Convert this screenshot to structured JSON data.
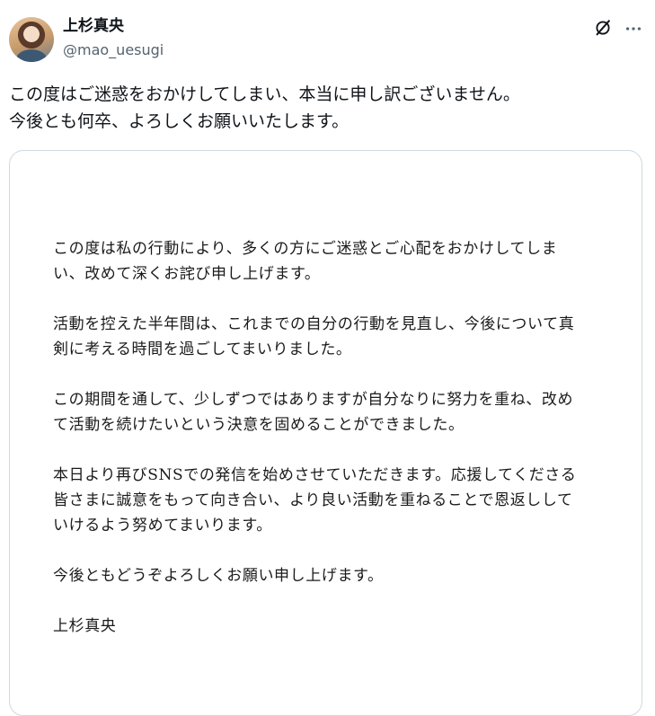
{
  "post": {
    "author": {
      "display_name": "上杉真央",
      "handle": "@mao_uesugi"
    },
    "text_lines": [
      "この度はご迷惑をおかけしてしまい、本当に申し訳ございません。",
      "今後とも何卒、よろしくお願いいたします。"
    ],
    "image": {
      "paragraphs": [
        "この度は私の行動により、多くの方にご迷惑とご心配をおかけしてしま\nい、改めて深くお詫び申し上げます。",
        "活動を控えた半年間は、これまでの自分の行動を見直し、今後について真\n剣に考える時間を過ごしてまいりました。",
        "この期間を通して、少しずつではありますが自分なりに努力を重ね、改め\nて活動を続けたいという決意を固めることができました。",
        "本日より再びSNSでの発信を始めさせていただきます。応援してくださる\n皆さまに誠意をもって向き合い、より良い活動を重ねることで恩返しして\nいけるよう努めてまいります。",
        "今後ともどうぞよろしくお願い申し上げます。"
      ],
      "signature": "上杉真央"
    }
  },
  "icons": {
    "grok": "grok-icon",
    "more": "more-options-icon",
    "avatar": "avatar-image"
  },
  "colors": {
    "text_primary": "#0f1419",
    "text_secondary": "#536471",
    "border": "#cfd9de"
  }
}
